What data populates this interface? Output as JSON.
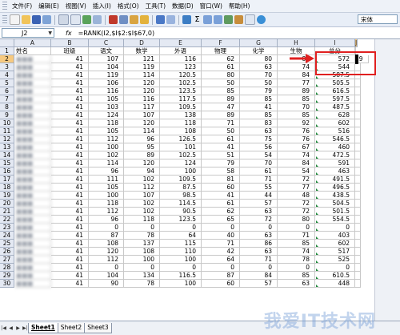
{
  "menu": [
    "文件(F)",
    "编辑(E)",
    "视图(V)",
    "插入(I)",
    "格式(O)",
    "工具(T)",
    "数据(D)",
    "窗口(W)",
    "帮助(H)"
  ],
  "toolbar": {
    "font_name": "宋体"
  },
  "formula_bar": {
    "name_box": "J2",
    "fx": "fx",
    "formula": "=RANK(I2,$I$2:$I$67,0)"
  },
  "columns": [
    "A",
    "B",
    "C",
    "D",
    "E",
    "F",
    "G",
    "H",
    "I",
    "J"
  ],
  "header_row": [
    "姓名",
    "班级",
    "语文",
    "数学",
    "外语",
    "物理",
    "化学",
    "生物",
    "总分",
    ""
  ],
  "rows": [
    [
      "41",
      "107",
      "121",
      "116",
      "62",
      "80",
      "86",
      "572",
      "19"
    ],
    [
      "41",
      "104",
      "119",
      "123",
      "61",
      "63",
      "74",
      "544",
      ""
    ],
    [
      "41",
      "119",
      "114",
      "120.5",
      "80",
      "70",
      "84",
      "587.5",
      ""
    ],
    [
      "41",
      "106",
      "120",
      "102.5",
      "50",
      "50",
      "77",
      "505.5",
      ""
    ],
    [
      "41",
      "116",
      "120",
      "123.5",
      "85",
      "79",
      "89",
      "616.5",
      ""
    ],
    [
      "41",
      "105",
      "116",
      "117.5",
      "89",
      "85",
      "85",
      "597.5",
      ""
    ],
    [
      "41",
      "103",
      "117",
      "109.5",
      "47",
      "41",
      "70",
      "487.5",
      ""
    ],
    [
      "41",
      "124",
      "107",
      "138",
      "89",
      "85",
      "85",
      "628",
      ""
    ],
    [
      "41",
      "118",
      "120",
      "118",
      "71",
      "83",
      "92",
      "602",
      ""
    ],
    [
      "41",
      "105",
      "114",
      "108",
      "50",
      "63",
      "76",
      "516",
      ""
    ],
    [
      "41",
      "112",
      "96",
      "126.5",
      "61",
      "75",
      "76",
      "546.5",
      ""
    ],
    [
      "41",
      "100",
      "95",
      "101",
      "41",
      "56",
      "67",
      "460",
      ""
    ],
    [
      "41",
      "102",
      "89",
      "102.5",
      "51",
      "54",
      "74",
      "472.5",
      ""
    ],
    [
      "41",
      "114",
      "120",
      "124",
      "79",
      "70",
      "84",
      "591",
      ""
    ],
    [
      "41",
      "96",
      "94",
      "100",
      "58",
      "61",
      "54",
      "463",
      ""
    ],
    [
      "41",
      "111",
      "102",
      "109.5",
      "81",
      "71",
      "72",
      "491.5",
      ""
    ],
    [
      "41",
      "105",
      "112",
      "87.5",
      "60",
      "55",
      "77",
      "496.5",
      ""
    ],
    [
      "41",
      "100",
      "107",
      "98.5",
      "41",
      "44",
      "48",
      "438.5",
      ""
    ],
    [
      "41",
      "118",
      "102",
      "114.5",
      "61",
      "57",
      "72",
      "504.5",
      ""
    ],
    [
      "41",
      "112",
      "102",
      "90.5",
      "62",
      "63",
      "72",
      "501.5",
      ""
    ],
    [
      "41",
      "96",
      "118",
      "123.5",
      "65",
      "72",
      "80",
      "554.5",
      ""
    ],
    [
      "41",
      "0",
      "0",
      "0",
      "0",
      "0",
      "0",
      "0",
      ""
    ],
    [
      "41",
      "87",
      "78",
      "64",
      "40",
      "63",
      "71",
      "403",
      ""
    ],
    [
      "41",
      "108",
      "137",
      "115",
      "71",
      "86",
      "85",
      "602",
      ""
    ],
    [
      "41",
      "120",
      "108",
      "110",
      "42",
      "63",
      "74",
      "517",
      ""
    ],
    [
      "41",
      "112",
      "100",
      "100",
      "64",
      "71",
      "78",
      "525",
      ""
    ],
    [
      "41",
      "0",
      "0",
      "0",
      "0",
      "0",
      "0",
      "0",
      ""
    ],
    [
      "41",
      "104",
      "134",
      "116.5",
      "87",
      "84",
      "85",
      "610.5",
      ""
    ],
    [
      "41",
      "90",
      "78",
      "100",
      "60",
      "57",
      "63",
      "448",
      ""
    ]
  ],
  "sheet_tabs": [
    "Sheet1",
    "Sheet2",
    "Sheet3"
  ],
  "watermark": "我爱IT技术网"
}
